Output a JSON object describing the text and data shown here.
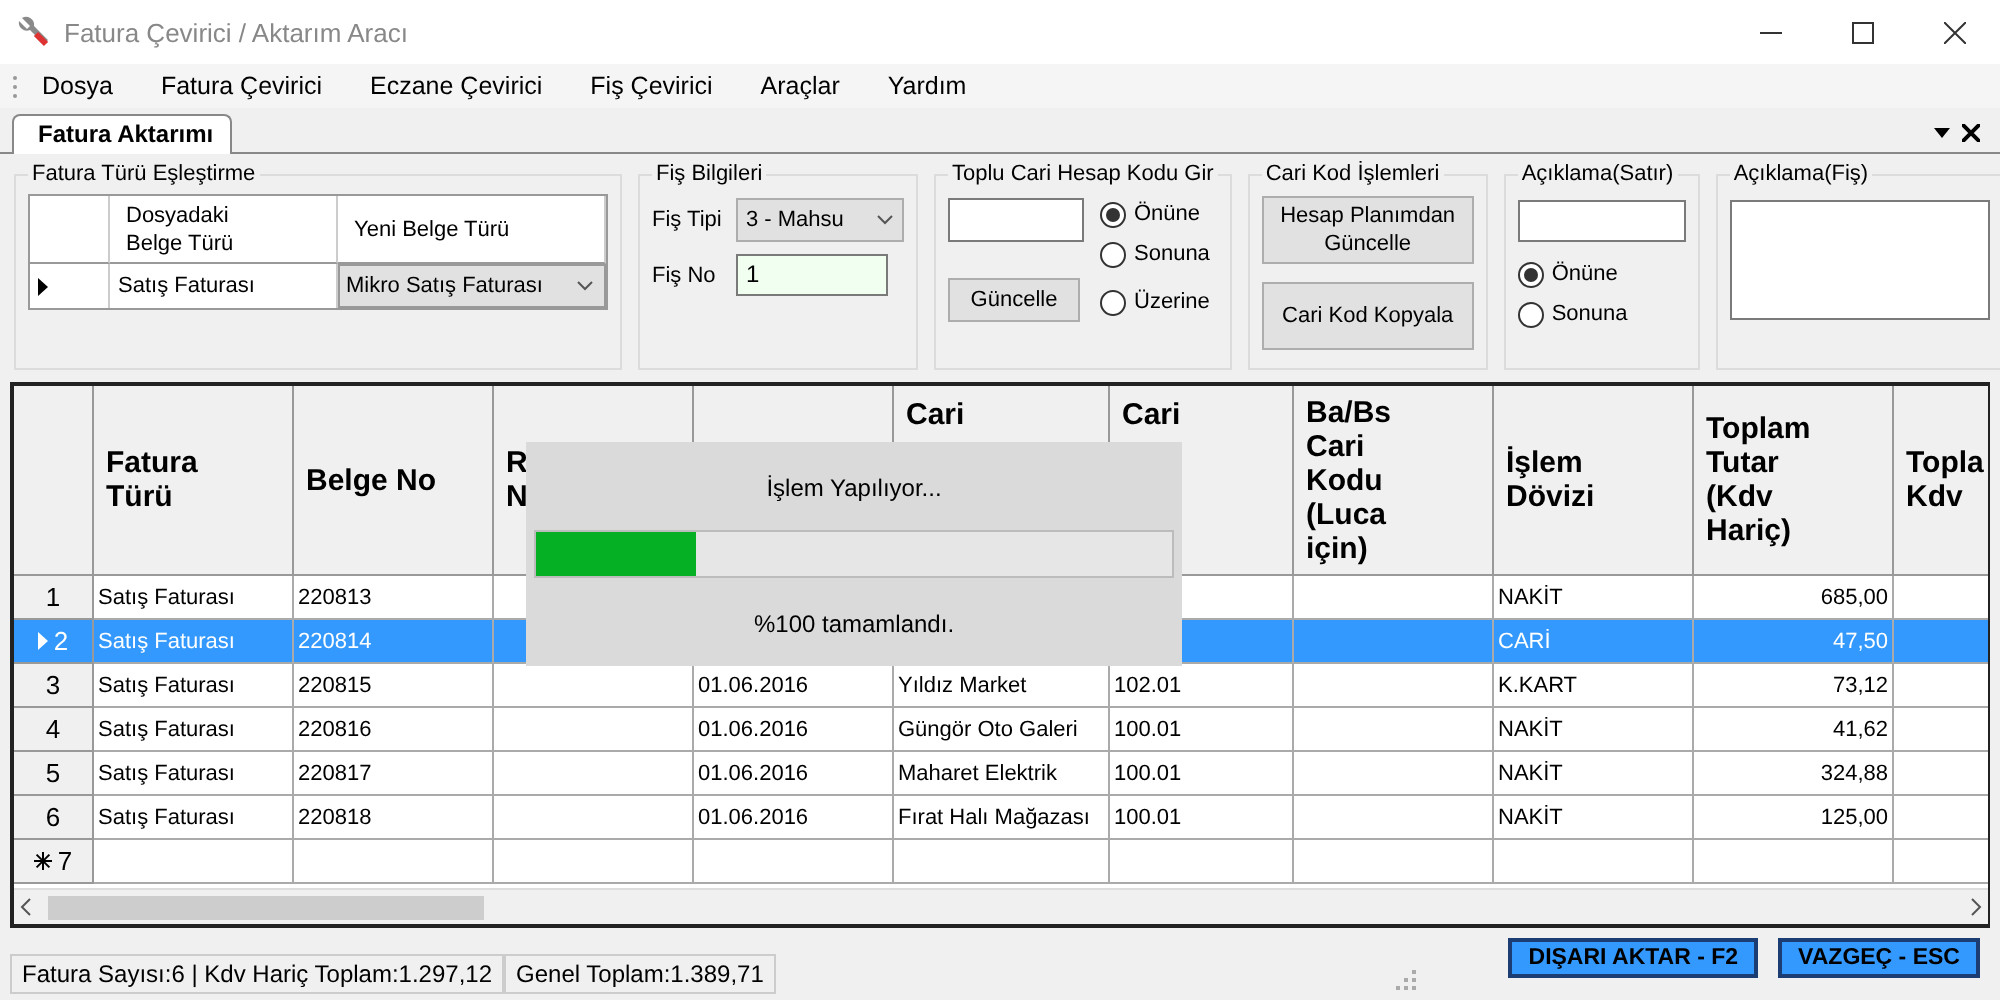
{
  "window": {
    "title": "Fatura Çevirici / Aktarım Aracı"
  },
  "menu": [
    "Dosya",
    "Fatura Çevirici",
    "Eczane Çevirici",
    "Fiş Çevirici",
    "Araçlar",
    "Yardım"
  ],
  "tabs": [
    {
      "label": "Fatura Aktarımı",
      "selected": true
    }
  ],
  "mapping": {
    "title": "Fatura Türü Eşleştirme",
    "columns": [
      "Dosyadaki\nBelge Türü",
      "Yeni Belge Türü"
    ],
    "rows": [
      {
        "source": "Satış Faturası",
        "target": "Mikro Satış Faturası",
        "selected": true
      }
    ]
  },
  "fis": {
    "title": "Fiş Bilgileri",
    "type_label": "Fiş Tipi",
    "type_value": "3 - Mahsu",
    "no_label": "Fiş No",
    "no_value": "1"
  },
  "toplu": {
    "title": "Toplu Cari Hesap Kodu Gir",
    "button": "Güncelle",
    "options": [
      {
        "label": "Önüne",
        "selected": true
      },
      {
        "label": "Sonuna",
        "selected": false
      },
      {
        "label": "Üzerine",
        "selected": false
      }
    ]
  },
  "cari_kod": {
    "title": "Cari Kod İşlemleri",
    "buttons": [
      "Hesap Planımdan\nGüncelle",
      "Cari Kod Kopyala"
    ]
  },
  "aciklama_satir": {
    "title": "Açıklama(Satır)",
    "options": [
      {
        "label": "Önüne",
        "selected": true
      },
      {
        "label": "Sonuna",
        "selected": false
      }
    ]
  },
  "aciklama_fis": {
    "title": "Açıklama(Fiş)"
  },
  "table": {
    "columns": [
      {
        "header": "Fatura\nTürü",
        "kind": "text"
      },
      {
        "header": "Belge No",
        "kind": "text"
      },
      {
        "header": "R\nN",
        "kind": "text"
      },
      {
        "kind": "text"
      },
      {
        "header": "Cari",
        "kind": "cut"
      },
      {
        "header": "Cari",
        "kind": "cut"
      },
      {
        "header": "Ba/Bs\nCari\nKodu\n(Luca\niçin)",
        "kind": "text"
      },
      {
        "header": "İşlem\nDövizi",
        "kind": "text"
      },
      {
        "header": "Toplam\nTutar\n(Kdv\nHariç)",
        "kind": "number"
      },
      {
        "header": "Topla\nKdv",
        "kind": "text"
      }
    ],
    "rows": [
      {
        "number": "1",
        "kind": "data",
        "selected": false,
        "cells": [
          "Satış Faturası",
          "220813",
          null,
          null,
          null,
          null,
          null,
          "NAKİT",
          "685,00",
          null
        ]
      },
      {
        "number": "2",
        "kind": "data",
        "selected": true,
        "cells": [
          "Satış Faturası",
          "220814",
          null,
          null,
          null,
          null,
          null,
          "CARİ",
          "47,50",
          null
        ]
      },
      {
        "number": "3",
        "kind": "data",
        "selected": false,
        "cells": [
          "Satış Faturası",
          "220815",
          null,
          "01.06.2016",
          "Yıldız Market",
          "102.01",
          null,
          "K.KART",
          "73,12",
          null
        ]
      },
      {
        "number": "4",
        "kind": "data",
        "selected": false,
        "cells": [
          "Satış Faturası",
          "220816",
          null,
          "01.06.2016",
          "Güngör Oto Galeri",
          "100.01",
          null,
          "NAKİT",
          "41,62",
          null
        ]
      },
      {
        "number": "5",
        "kind": "data",
        "selected": false,
        "cells": [
          "Satış Faturası",
          "220817",
          null,
          "01.06.2016",
          "Maharet Elektrik",
          "100.01",
          null,
          "NAKİT",
          "324,88",
          null
        ]
      },
      {
        "number": "6",
        "kind": "data",
        "selected": false,
        "cells": [
          "Satış Faturası",
          "220818",
          null,
          "01.06.2016",
          "Fırat Halı Mağazası",
          "100.01",
          null,
          "NAKİT",
          "125,00",
          null
        ]
      },
      {
        "number": "7",
        "kind": "new",
        "selected": false
      }
    ]
  },
  "progress": {
    "title": "İşlem Yapılıyor...",
    "level": 0.25,
    "message": "%100 tamamlandı."
  },
  "status_bar": [
    "Fatura Sayısı:6 | Kdv Hariç Toplam:1.297,12",
    "Genel Toplam:1.389,71"
  ],
  "buttons": [
    "DIŞARI AKTAR - F2",
    "VAZGEÇ - ESC"
  ]
}
